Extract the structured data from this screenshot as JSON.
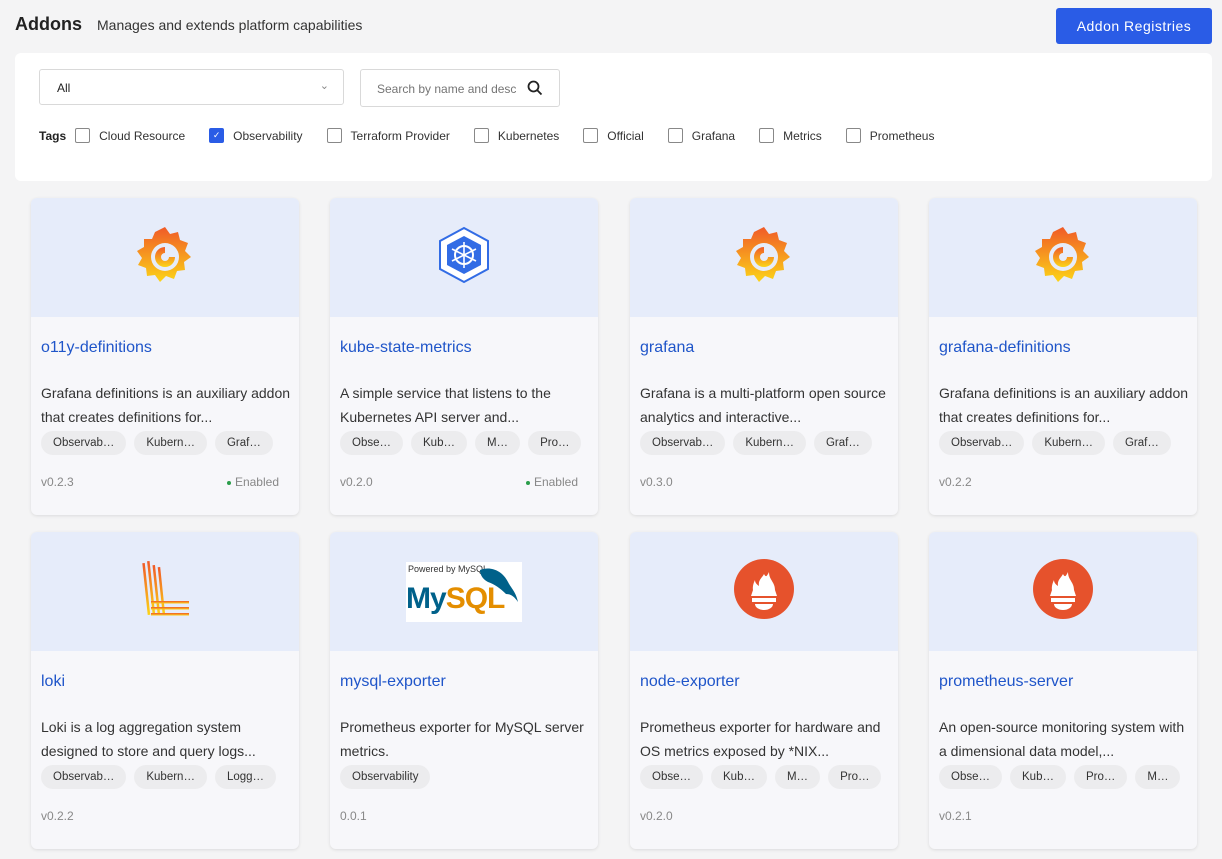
{
  "header": {
    "title": "Addons",
    "subtitle": "Manages and extends platform capabilities",
    "registries_button": "Addon Registries"
  },
  "filters": {
    "registry_select": "All",
    "search_placeholder": "Search by name and description",
    "tags_label": "Tags",
    "tags": [
      {
        "label": "Cloud Resource",
        "checked": false
      },
      {
        "label": "Observability",
        "checked": true
      },
      {
        "label": "Terraform Provider",
        "checked": false
      },
      {
        "label": "Kubernetes",
        "checked": false
      },
      {
        "label": "Official",
        "checked": false
      },
      {
        "label": "Grafana",
        "checked": false
      },
      {
        "label": "Metrics",
        "checked": false
      },
      {
        "label": "Prometheus",
        "checked": false
      }
    ]
  },
  "colors": {
    "accent": "#2a5ce6",
    "enabled": "#2a9d4a",
    "link": "#1f55c9"
  },
  "addons": [
    {
      "name": "o11y-definitions",
      "icon": "grafana-icon",
      "description": "Grafana definitions is an auxiliary addon that creates definitions for...",
      "tags": [
        "Observab…",
        "Kubern…",
        "Graf…"
      ],
      "version": "v0.2.3",
      "status": "Enabled"
    },
    {
      "name": "kube-state-metrics",
      "icon": "kubernetes-icon",
      "description": "A simple service that listens to the Kubernetes API server and...",
      "tags": [
        "Obse…",
        "Kub…",
        "M…",
        "Pro…"
      ],
      "version": "v0.2.0",
      "status": "Enabled"
    },
    {
      "name": "grafana",
      "icon": "grafana-icon",
      "description": "Grafana is a multi-platform open source analytics and interactive...",
      "tags": [
        "Observab…",
        "Kubern…",
        "Graf…"
      ],
      "version": "v0.3.0",
      "status": ""
    },
    {
      "name": "grafana-definitions",
      "icon": "grafana-icon",
      "description": "Grafana definitions is an auxiliary addon that creates definitions for...",
      "tags": [
        "Observab…",
        "Kubern…",
        "Graf…"
      ],
      "version": "v0.2.2",
      "status": ""
    },
    {
      "name": "loki",
      "icon": "loki-icon",
      "description": "Loki is a log aggregation system designed to store and query logs...",
      "tags": [
        "Observab…",
        "Kubern…",
        "Logg…"
      ],
      "version": "v0.2.2",
      "status": ""
    },
    {
      "name": "mysql-exporter",
      "icon": "mysql-icon",
      "logo_text": "Powered by MySQL",
      "description": "Prometheus exporter for MySQL server metrics.",
      "tags": [
        "Observability"
      ],
      "version": "0.0.1",
      "status": ""
    },
    {
      "name": "node-exporter",
      "icon": "prometheus-icon",
      "description": "Prometheus exporter for hardware and OS metrics exposed by *NIX...",
      "tags": [
        "Obse…",
        "Kub…",
        "M…",
        "Pro…"
      ],
      "version": "v0.2.0",
      "status": ""
    },
    {
      "name": "prometheus-server",
      "icon": "prometheus-icon",
      "description": "An open-source monitoring system with a dimensional data model,...",
      "tags": [
        "Obse…",
        "Kub…",
        "Pro…",
        "M…"
      ],
      "version": "v0.2.1",
      "status": ""
    }
  ]
}
